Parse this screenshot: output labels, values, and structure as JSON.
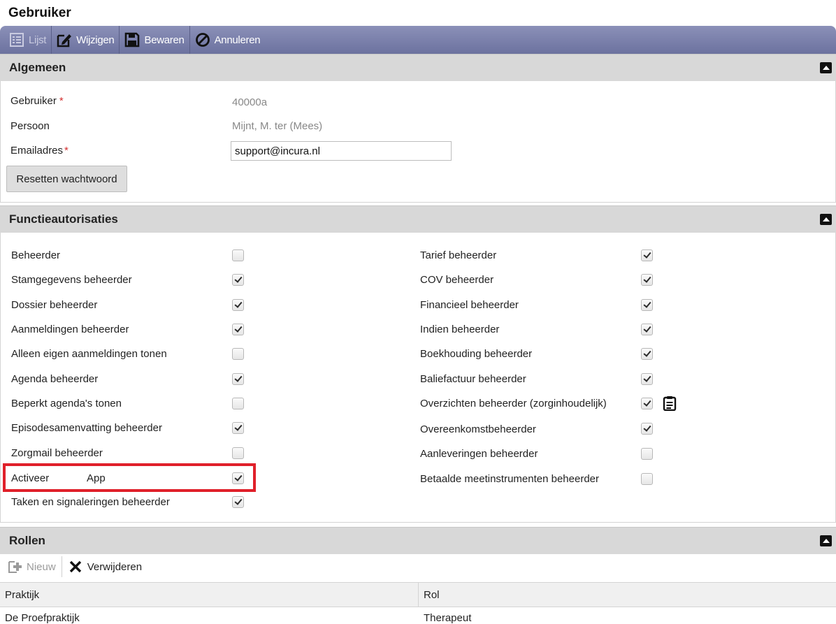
{
  "page": {
    "title": "Gebruiker"
  },
  "toolbar": {
    "lijst_label": "Lijst",
    "wijzigen_label": "Wijzigen",
    "bewaren_label": "Bewaren",
    "annuleren_label": "Annuleren"
  },
  "algemeen": {
    "title": "Algemeen",
    "gebruiker_label": "Gebruiker",
    "gebruiker_value": "40000a",
    "persoon_label": "Persoon",
    "persoon_value": "Mijnt, M. ter (Mees)",
    "email_label": "Emailadres",
    "email_value": "support@incura.nl",
    "required_mark": "*",
    "reset_label": "Resetten wachtwoord"
  },
  "functie": {
    "title": "Functieautorisaties",
    "left": [
      {
        "label": "Beheerder",
        "checked": false
      },
      {
        "label": "Stamgegevens beheerder",
        "checked": true
      },
      {
        "label": "Dossier beheerder",
        "checked": true
      },
      {
        "label": "Aanmeldingen beheerder",
        "checked": true
      },
      {
        "label": "Alleen eigen aanmeldingen tonen",
        "checked": false
      },
      {
        "label": "Agenda beheerder",
        "checked": true
      },
      {
        "label": "Beperkt agenda's tonen",
        "checked": false
      },
      {
        "label": "Episodesamenvatting beheerder",
        "checked": true
      },
      {
        "label": "Zorgmail beheerder",
        "checked": false
      },
      {
        "label": "Activeer",
        "label2": "App",
        "checked": true
      },
      {
        "label": "Taken en signaleringen beheerder",
        "checked": true
      }
    ],
    "right": [
      {
        "label": "Tarief beheerder",
        "checked": true
      },
      {
        "label": "COV beheerder",
        "checked": true
      },
      {
        "label": "Financieel beheerder",
        "checked": true
      },
      {
        "label": "Indien beheerder",
        "checked": true
      },
      {
        "label": "Boekhouding beheerder",
        "checked": true
      },
      {
        "label": "Baliefactuur beheerder",
        "checked": true
      },
      {
        "label": "Overzichten beheerder (zorginhoudelijk)",
        "checked": true
      },
      {
        "label": "Overeenkomstbeheerder",
        "checked": true
      },
      {
        "label": "Aanleveringen beheerder",
        "checked": false
      },
      {
        "label": "Betaalde meetinstrumenten beheerder",
        "checked": false
      }
    ]
  },
  "rollen": {
    "title": "Rollen",
    "nieuw_label": "Nieuw",
    "verwijderen_label": "Verwijderen",
    "columns": [
      "Praktijk",
      "Rol"
    ],
    "rows": [
      [
        "De Proefpraktijk",
        "Therapeut"
      ]
    ]
  },
  "colors": {
    "toolbar": "#7a7fab",
    "section_header": "#d8d8d8",
    "highlight": "#e0202a"
  }
}
